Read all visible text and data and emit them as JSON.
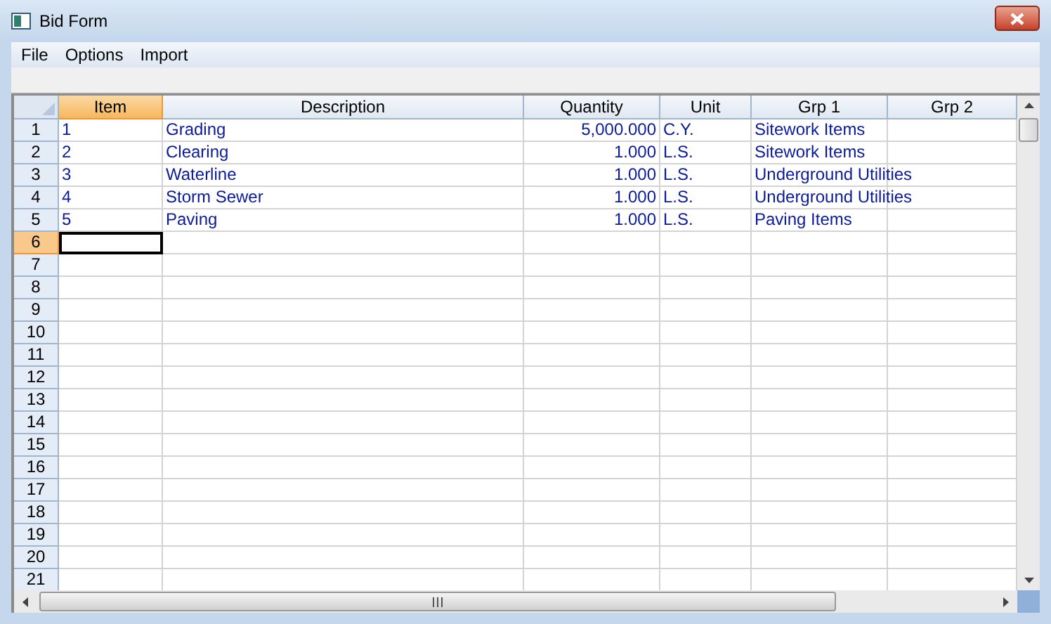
{
  "window": {
    "title": "Bid Form"
  },
  "menu": [
    {
      "label": "File"
    },
    {
      "label": "Options"
    },
    {
      "label": "Import"
    }
  ],
  "table": {
    "columns": [
      {
        "label": "Item",
        "selected": true,
        "kind": "text"
      },
      {
        "label": "Description",
        "selected": false,
        "kind": "text"
      },
      {
        "label": "Quantity",
        "selected": false,
        "kind": "number"
      },
      {
        "label": "Unit",
        "selected": false,
        "kind": "text"
      },
      {
        "label": "Grp 1",
        "selected": false,
        "kind": "text"
      },
      {
        "label": "Grp 2",
        "selected": false,
        "kind": "text"
      }
    ],
    "rows": [
      {
        "number": "1",
        "selected": false,
        "cells": [
          "1",
          "Grading",
          "5,000.000",
          "C.Y.",
          "Sitework Items",
          ""
        ]
      },
      {
        "number": "2",
        "selected": false,
        "cells": [
          "2",
          "Clearing",
          "1.000",
          "L.S.",
          "Sitework Items",
          ""
        ]
      },
      {
        "number": "3",
        "selected": false,
        "cells": [
          "3",
          "Waterline",
          "1.000",
          "L.S.",
          "Underground Utilities",
          ""
        ]
      },
      {
        "number": "4",
        "selected": false,
        "cells": [
          "4",
          "Storm Sewer",
          "1.000",
          "L.S.",
          "Underground Utilities",
          ""
        ]
      },
      {
        "number": "5",
        "selected": false,
        "cells": [
          "5",
          "Paving",
          "1.000",
          "L.S.",
          "Paving Items",
          ""
        ]
      },
      {
        "number": "6",
        "selected": true
      },
      {
        "number": "7",
        "selected": false
      },
      {
        "number": "8",
        "selected": false
      },
      {
        "number": "9",
        "selected": false
      },
      {
        "number": "10",
        "selected": false
      },
      {
        "number": "11",
        "selected": false
      },
      {
        "number": "12",
        "selected": false
      },
      {
        "number": "13",
        "selected": false
      },
      {
        "number": "14",
        "selected": false
      },
      {
        "number": "15",
        "selected": false
      },
      {
        "number": "16",
        "selected": false
      },
      {
        "number": "17",
        "selected": false
      },
      {
        "number": "18",
        "selected": false
      },
      {
        "number": "19",
        "selected": false
      },
      {
        "number": "20",
        "selected": false
      },
      {
        "number": "21",
        "selected": false
      }
    ]
  }
}
